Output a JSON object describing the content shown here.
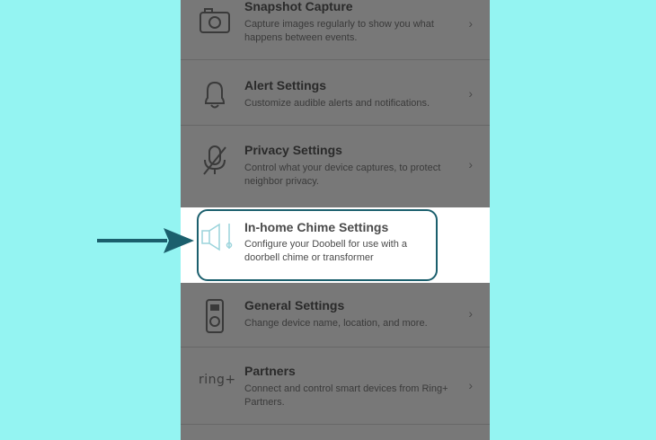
{
  "settings": {
    "snapshot": {
      "title": "Snapshot Capture",
      "desc": "Capture images regularly to show you what happens between events.",
      "icon": "camera-icon"
    },
    "alert": {
      "title": "Alert Settings",
      "desc": "Customize audible alerts and notifications.",
      "icon": "bell-icon"
    },
    "privacy": {
      "title": "Privacy Settings",
      "desc": "Control what your device captures, to protect neighbor privacy.",
      "icon": "mic-off-icon"
    },
    "chime": {
      "title": "In-home Chime Settings",
      "desc": "Configure your Doobell for use with a doorbell chime or transformer",
      "icon": "chime-speaker-icon"
    },
    "general": {
      "title": "General Settings",
      "desc": "Change device name, location, and more.",
      "icon": "doorbell-device-icon"
    },
    "partners": {
      "title": "Partners",
      "desc": "Connect and control smart devices from Ring+ Partners.",
      "logo": "ring+",
      "icon": "ring-plus-logo"
    }
  },
  "chevron": "›",
  "colors": {
    "background": "#94f4f2",
    "overlay": "#787878",
    "highlight_border": "#1b5f6d",
    "arrow": "#1b5f6d"
  }
}
